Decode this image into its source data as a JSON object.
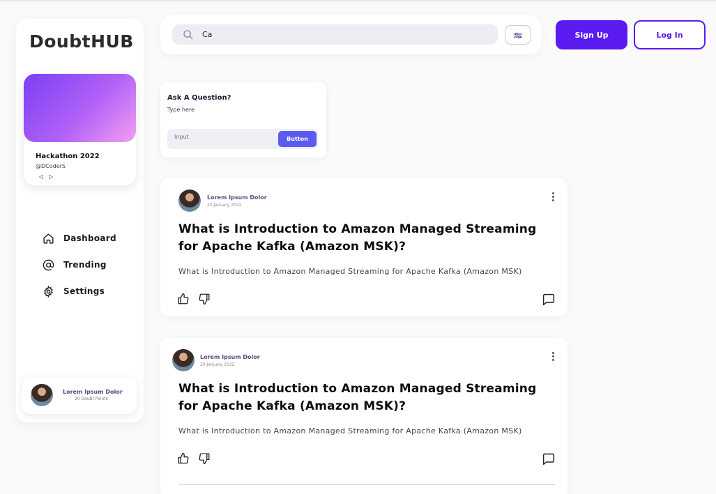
{
  "app": {
    "logo": "DoubtHUB"
  },
  "event_card": {
    "title": "Hackathon 2022",
    "handle": "@DCoderS",
    "prev_label": "◁",
    "next_label": "▷"
  },
  "sidebar": {
    "items": [
      {
        "label": "Dashboard",
        "icon": "home-icon"
      },
      {
        "label": "Trending",
        "icon": "at-icon"
      },
      {
        "label": "Settings",
        "icon": "gear-icon"
      }
    ],
    "profile": {
      "name": "Lorem Ipsum Dolor",
      "points": "20 Doubt Points"
    }
  },
  "search": {
    "value": "Ca",
    "icon": "search-icon",
    "filter_icon": "filter-icon"
  },
  "header": {
    "signup_label": "Sign Up",
    "login_label": "Log In"
  },
  "ask": {
    "title": "Ask A Question?",
    "subtitle": "Type here",
    "input_placeholder": "Input",
    "button_label": "Button"
  },
  "questions": [
    {
      "author": "Lorem Ipsum Dolor",
      "date": "20 January 2022",
      "title": "What is Introduction to Amazon Managed Streaming for Apache Kafka (Amazon MSK)?",
      "body": "What is Introduction to Amazon Managed Streaming for Apache Kafka (Amazon MSK)"
    },
    {
      "author": "Lorem Ipsum Dolor",
      "date": "20 January 2022",
      "title": "What is Introduction to Amazon Managed Streaming for Apache Kafka (Amazon MSK)?",
      "body": "What is Introduction to Amazon Managed Streaming for Apache Kafka (Amazon MSK)"
    }
  ],
  "colors": {
    "accent": "#5a1bf0",
    "ask_button": "#5b5bf0",
    "banner_gradient": [
      "#7b3ff5",
      "#f39ff3"
    ]
  }
}
